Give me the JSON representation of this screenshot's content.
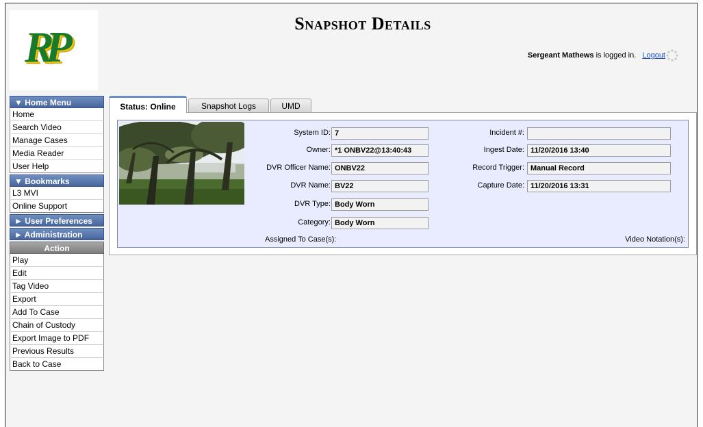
{
  "header": {
    "logo_text": "RP",
    "page_title": "Snapshot Details",
    "user_name": "Sergeant Mathews",
    "logged_in_text": " is logged in.",
    "logout_label": "Logout"
  },
  "sidebar": {
    "home_menu": {
      "title": "▼ Home Menu",
      "items": [
        "Home",
        "Search Video",
        "Manage Cases",
        "Media Reader",
        "User Help"
      ]
    },
    "bookmarks": {
      "title": "▼  Bookmarks",
      "items": [
        "L3 MVI",
        "Online Support"
      ]
    },
    "user_preferences": {
      "title": "► User Preferences"
    },
    "administration": {
      "title": "► Administration"
    },
    "action": {
      "title": "Action",
      "items": [
        "Play",
        "Edit",
        "Tag Video",
        "Export",
        "Add To Case",
        "Chain of Custody",
        "Export Image to PDF",
        "Previous Results",
        "Back to Case"
      ]
    }
  },
  "tabs": [
    "Status: Online",
    "Snapshot Logs",
    "UMD"
  ],
  "details": {
    "system_id_label": "System ID:",
    "system_id": "7",
    "owner_label": "Owner:",
    "owner": "*1 ONBV22@13:40:43",
    "dvr_officer_label": "DVR Officer Name:",
    "dvr_officer": "ONBV22",
    "dvr_name_label": "DVR Name:",
    "dvr_name": "BV22",
    "dvr_type_label": "DVR Type:",
    "dvr_type": "Body Worn",
    "category_label": "Category:",
    "category": "Body Worn",
    "incident_label": "Incident #:",
    "incident": "",
    "ingest_label": "Ingest Date:",
    "ingest_date": "11/20/2016 13:40",
    "trigger_label": "Record Trigger:",
    "trigger": "Manual Record",
    "capture_label": "Capture Date:",
    "capture_date": "11/20/2016 13:31",
    "assigned_label": "Assigned To Case(s):",
    "notation_label": "Video Notation(s):"
  },
  "colors": {
    "sidebar_header": "#47659c",
    "action_header": "#7d7d7d",
    "panel_bg": "#e9ecff",
    "logo_green": "#1a7a2c",
    "logo_gold": "#f1c50e",
    "link": "#1a4ec9"
  }
}
